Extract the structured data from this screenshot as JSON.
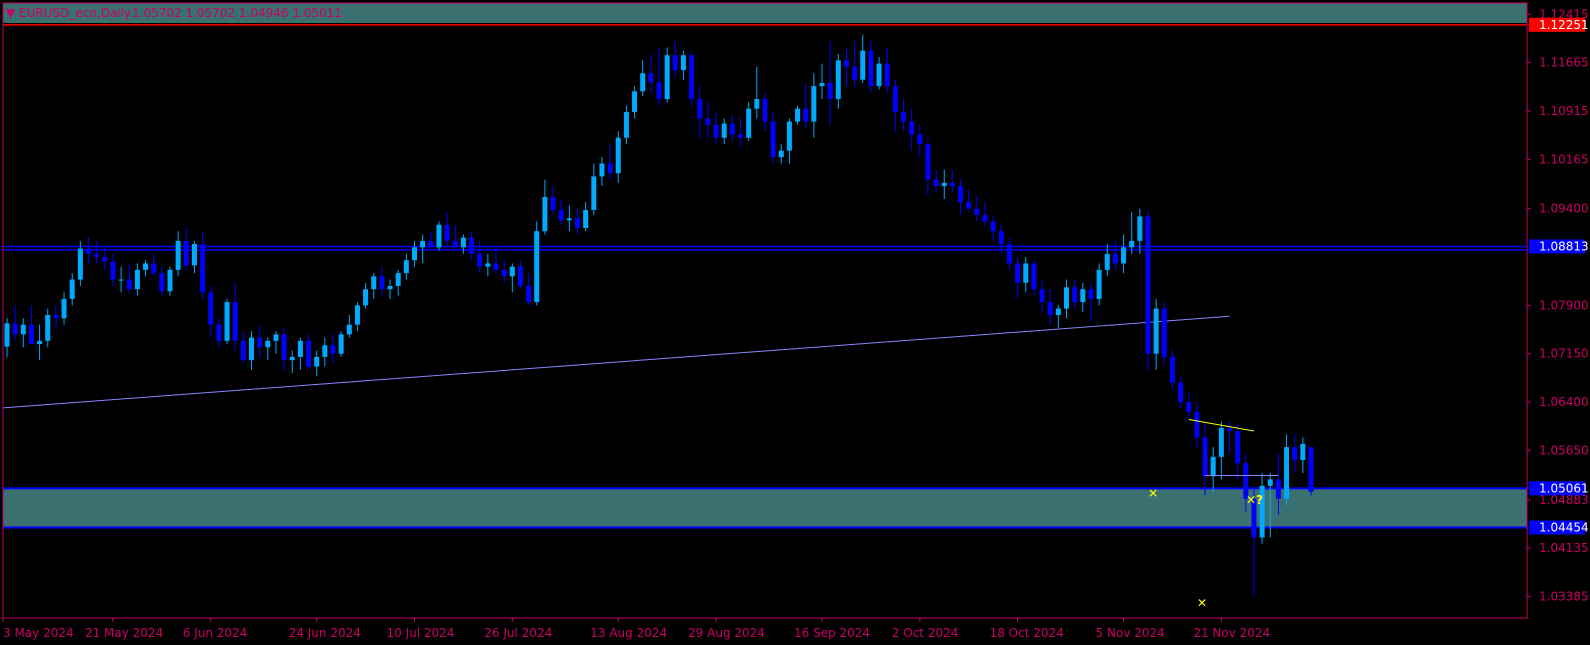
{
  "header": {
    "symbol_label": "EURUSD_ecn,Daily",
    "ohlc": "1.05702 1.05702 1.04946 1.05011",
    "arrow_glyph": "▼"
  },
  "colors": {
    "background": "#000000",
    "frame": "#cc0066",
    "axis_text": "#cc0066",
    "bull_candle": "#00aaff",
    "bear_candle": "#0000ff",
    "zone_fill": "#3a7070",
    "zone_border": "#0000ff",
    "trendline": "#8888ff",
    "level_line": "#0000ff",
    "price_tag_red": "#ff0000",
    "price_tag_blue": "#0000ff",
    "marker": "#ffff00"
  },
  "chart_data": {
    "type": "candlestick",
    "symbol": "EURUSD_ecn",
    "timeframe": "Daily",
    "ylim": [
      1.0305,
      1.1259
    ],
    "yticks": [
      "1.12415",
      "1.11665",
      "1.10915",
      "1.10165",
      "1.09400",
      "1.07900",
      "1.07150",
      "1.06400",
      "1.05650",
      "1.04883",
      "1.04135",
      "1.03385"
    ],
    "xticks": [
      "3 May 2024",
      "21 May 2024",
      "6 Jun 2024",
      "24 Jun 2024",
      "10 Jul 2024",
      "26 Jul 2024",
      "13 Aug 2024",
      "29 Aug 2024",
      "16 Sep 2024",
      "2 Oct 2024",
      "18 Oct 2024",
      "5 Nov 2024",
      "21 Nov 2024"
    ],
    "xtick_index": [
      0,
      13,
      25,
      38,
      50,
      62,
      75,
      87,
      100,
      112,
      124,
      137,
      149
    ],
    "price_tags": [
      {
        "label": "1.12251",
        "value": 1.12251,
        "kind": "red"
      },
      {
        "label": "1.08813",
        "value": 1.08813,
        "kind": "blue"
      },
      {
        "label": "1.05061",
        "value": 1.05061,
        "kind": "blue"
      },
      {
        "label": "1.04454",
        "value": 1.04454,
        "kind": "blue"
      }
    ],
    "horizontal_levels": [
      1.12251,
      1.08813,
      1.0876
    ],
    "zone": {
      "top": 1.05061,
      "bottom": 1.04454
    },
    "trendline": {
      "from": {
        "index": 0,
        "value": 1.0631
      },
      "to": {
        "index": 150,
        "value": 1.0773
      }
    },
    "yellow_lines": [
      {
        "from": {
          "index": 145,
          "value": 1.0613
        },
        "to": {
          "index": 153,
          "value": 1.0595
        }
      },
      {
        "from": {
          "index": 147,
          "value": 1.0526
        },
        "to": {
          "index": 156,
          "value": 1.0526
        }
      }
    ],
    "markers": [
      {
        "index": 141,
        "value": 1.0492,
        "text": "✕"
      },
      {
        "index": 147,
        "value": 1.0322,
        "text": "✕"
      },
      {
        "index": 153,
        "value": 1.0482,
        "text": "✕?"
      }
    ],
    "candles": [
      [
        1.0726,
        1.077,
        1.0709,
        1.0762
      ],
      [
        1.0762,
        1.079,
        1.0735,
        1.0745
      ],
      [
        1.0745,
        1.077,
        1.0725,
        1.076
      ],
      [
        1.076,
        1.079,
        1.0745,
        1.073
      ],
      [
        1.073,
        1.076,
        1.0705,
        1.0735
      ],
      [
        1.0735,
        1.0785,
        1.0725,
        1.0775
      ],
      [
        1.0775,
        1.079,
        1.0755,
        1.077
      ],
      [
        1.077,
        1.081,
        1.076,
        1.08
      ],
      [
        1.08,
        1.084,
        1.079,
        1.083
      ],
      [
        1.083,
        1.089,
        1.082,
        1.0878
      ],
      [
        1.0878,
        1.0895,
        1.0855,
        1.087
      ],
      [
        1.087,
        1.089,
        1.0855,
        1.0865
      ],
      [
        1.0865,
        1.088,
        1.0845,
        1.0858
      ],
      [
        1.0858,
        1.087,
        1.082,
        1.083
      ],
      [
        1.083,
        1.085,
        1.081,
        1.083
      ],
      [
        1.083,
        1.0855,
        1.081,
        1.0815
      ],
      [
        1.0815,
        1.0855,
        1.0805,
        1.0845
      ],
      [
        1.0845,
        1.086,
        1.0835,
        1.0855
      ],
      [
        1.0855,
        1.087,
        1.0835,
        1.084
      ],
      [
        1.084,
        1.085,
        1.0805,
        1.0812
      ],
      [
        1.0812,
        1.085,
        1.0805,
        1.0845
      ],
      [
        1.0845,
        1.0905,
        1.0835,
        1.089
      ],
      [
        1.089,
        1.091,
        1.0845,
        1.0852
      ],
      [
        1.0852,
        1.089,
        1.084,
        1.0885
      ],
      [
        1.0885,
        1.0905,
        1.08,
        1.081
      ],
      [
        1.081,
        1.082,
        1.074,
        1.076
      ],
      [
        1.076,
        1.077,
        1.0725,
        1.0735
      ],
      [
        1.0735,
        1.08,
        1.073,
        1.0795
      ],
      [
        1.0795,
        1.0825,
        1.072,
        1.0735
      ],
      [
        1.0735,
        1.075,
        1.07,
        1.0705
      ],
      [
        1.0705,
        1.075,
        1.069,
        1.074
      ],
      [
        1.074,
        1.076,
        1.071,
        1.0725
      ],
      [
        1.0725,
        1.074,
        1.0705,
        1.0735
      ],
      [
        1.0735,
        1.075,
        1.0715,
        1.0745
      ],
      [
        1.0745,
        1.0755,
        1.069,
        1.0705
      ],
      [
        1.0705,
        1.072,
        1.0685,
        1.071
      ],
      [
        1.071,
        1.074,
        1.069,
        1.0735
      ],
      [
        1.0735,
        1.0745,
        1.069,
        1.0695
      ],
      [
        1.0695,
        1.072,
        1.068,
        1.071
      ],
      [
        1.071,
        1.074,
        1.0695,
        1.0728
      ],
      [
        1.0728,
        1.0745,
        1.07,
        1.0715
      ],
      [
        1.0715,
        1.075,
        1.071,
        1.0745
      ],
      [
        1.0745,
        1.0775,
        1.074,
        1.076
      ],
      [
        1.076,
        1.0795,
        1.075,
        1.079
      ],
      [
        1.079,
        1.0825,
        1.0785,
        1.0815
      ],
      [
        1.0815,
        1.084,
        1.08,
        1.0835
      ],
      [
        1.0835,
        1.085,
        1.0805,
        1.0815
      ],
      [
        1.0815,
        1.083,
        1.08,
        1.082
      ],
      [
        1.082,
        1.0845,
        1.0805,
        1.084
      ],
      [
        1.084,
        1.087,
        1.083,
        1.086
      ],
      [
        1.086,
        1.089,
        1.085,
        1.088
      ],
      [
        1.088,
        1.09,
        1.0855,
        1.089
      ],
      [
        1.089,
        1.0905,
        1.0875,
        1.088
      ],
      [
        1.088,
        1.092,
        1.0875,
        1.0915
      ],
      [
        1.0915,
        1.0935,
        1.088,
        1.089
      ],
      [
        1.089,
        1.0915,
        1.0875,
        1.088
      ],
      [
        1.088,
        1.09,
        1.087,
        1.0895
      ],
      [
        1.0895,
        1.0905,
        1.086,
        1.087
      ],
      [
        1.087,
        1.089,
        1.084,
        1.085
      ],
      [
        1.085,
        1.087,
        1.0835,
        1.0855
      ],
      [
        1.0855,
        1.088,
        1.084,
        1.0845
      ],
      [
        1.0845,
        1.086,
        1.0825,
        1.0835
      ],
      [
        1.0835,
        1.0855,
        1.081,
        1.085
      ],
      [
        1.085,
        1.086,
        1.0815,
        1.082
      ],
      [
        1.082,
        1.084,
        1.079,
        1.0795
      ],
      [
        1.0795,
        1.092,
        1.079,
        1.0905
      ],
      [
        1.0905,
        1.0985,
        1.09,
        1.0958
      ],
      [
        1.0958,
        1.0975,
        1.093,
        1.0938
      ],
      [
        1.0938,
        1.0955,
        1.0915,
        1.0922
      ],
      [
        1.0922,
        1.0945,
        1.0905,
        1.0925
      ],
      [
        1.0925,
        1.094,
        1.09,
        1.091
      ],
      [
        1.091,
        1.095,
        1.0905,
        1.0938
      ],
      [
        1.0938,
        1.101,
        1.093,
        1.099
      ],
      [
        1.099,
        1.102,
        1.0975,
        1.101
      ],
      [
        1.101,
        1.104,
        1.0985,
        1.0995
      ],
      [
        1.0995,
        1.106,
        1.098,
        1.105
      ],
      [
        1.105,
        1.11,
        1.104,
        1.109
      ],
      [
        1.109,
        1.113,
        1.108,
        1.1122
      ],
      [
        1.1122,
        1.117,
        1.1115,
        1.115
      ],
      [
        1.115,
        1.118,
        1.112,
        1.1136
      ],
      [
        1.1136,
        1.119,
        1.11,
        1.111
      ],
      [
        1.111,
        1.119,
        1.1105,
        1.1178
      ],
      [
        1.1178,
        1.12,
        1.1145,
        1.1155
      ],
      [
        1.1155,
        1.1185,
        1.114,
        1.1178
      ],
      [
        1.1178,
        1.1185,
        1.11,
        1.111
      ],
      [
        1.111,
        1.113,
        1.105,
        1.108
      ],
      [
        1.108,
        1.1105,
        1.105,
        1.107
      ],
      [
        1.107,
        1.109,
        1.104,
        1.105
      ],
      [
        1.105,
        1.108,
        1.104,
        1.1072
      ],
      [
        1.1072,
        1.1085,
        1.1045,
        1.1055
      ],
      [
        1.1055,
        1.108,
        1.1035,
        1.105
      ],
      [
        1.105,
        1.1105,
        1.1045,
        1.1095
      ],
      [
        1.1095,
        1.116,
        1.108,
        1.111
      ],
      [
        1.111,
        1.112,
        1.106,
        1.1075
      ],
      [
        1.1075,
        1.109,
        1.101,
        1.102
      ],
      [
        1.102,
        1.104,
        1.101,
        1.103
      ],
      [
        1.103,
        1.108,
        1.101,
        1.1075
      ],
      [
        1.1075,
        1.11,
        1.107,
        1.1095
      ],
      [
        1.1095,
        1.1135,
        1.1065,
        1.1075
      ],
      [
        1.1075,
        1.115,
        1.105,
        1.113
      ],
      [
        1.113,
        1.1165,
        1.111,
        1.1135
      ],
      [
        1.1135,
        1.12,
        1.107,
        1.111
      ],
      [
        1.111,
        1.118,
        1.1095,
        1.117
      ],
      [
        1.117,
        1.119,
        1.113,
        1.116
      ],
      [
        1.116,
        1.12,
        1.113,
        1.114
      ],
      [
        1.114,
        1.121,
        1.1135,
        1.1185
      ],
      [
        1.1185,
        1.12,
        1.112,
        1.113
      ],
      [
        1.113,
        1.1175,
        1.1125,
        1.1165
      ],
      [
        1.1165,
        1.119,
        1.112,
        1.113
      ],
      [
        1.113,
        1.114,
        1.106,
        1.109
      ],
      [
        1.109,
        1.111,
        1.106,
        1.1075
      ],
      [
        1.1075,
        1.1095,
        1.103,
        1.1055
      ],
      [
        1.1055,
        1.107,
        1.102,
        1.104
      ],
      [
        1.104,
        1.105,
        1.096,
        1.0985
      ],
      [
        1.0985,
        1.1,
        1.0965,
        1.0975
      ],
      [
        1.0975,
        1.1,
        1.0955,
        1.098
      ],
      [
        1.098,
        1.1,
        1.0965,
        1.0975
      ],
      [
        1.0975,
        1.0985,
        1.093,
        1.095
      ],
      [
        1.095,
        1.097,
        1.0935,
        1.094
      ],
      [
        1.094,
        1.096,
        1.092,
        1.093
      ],
      [
        1.093,
        1.095,
        1.0915,
        1.092
      ],
      [
        1.092,
        1.093,
        1.089,
        1.0905
      ],
      [
        1.0905,
        1.0915,
        1.087,
        1.0885
      ],
      [
        1.0885,
        1.0895,
        1.0845,
        1.0855
      ],
      [
        1.0855,
        1.0865,
        1.08,
        1.0825
      ],
      [
        1.0825,
        1.0865,
        1.081,
        1.0855
      ],
      [
        1.0855,
        1.086,
        1.0805,
        1.0815
      ],
      [
        1.0815,
        1.083,
        1.078,
        1.0795
      ],
      [
        1.0795,
        1.0815,
        1.076,
        1.0775
      ],
      [
        1.0775,
        1.079,
        1.0755,
        1.0785
      ],
      [
        1.0785,
        1.083,
        1.077,
        1.0818
      ],
      [
        1.0818,
        1.083,
        1.0785,
        1.0795
      ],
      [
        1.0795,
        1.0825,
        1.078,
        1.0815
      ],
      [
        1.0815,
        1.0825,
        1.0765,
        1.08
      ],
      [
        1.08,
        1.0855,
        1.079,
        1.0845
      ],
      [
        1.0845,
        1.0885,
        1.0835,
        1.087
      ],
      [
        1.087,
        1.089,
        1.0845,
        1.0855
      ],
      [
        1.0855,
        1.09,
        1.084,
        1.088
      ],
      [
        1.088,
        1.0935,
        1.087,
        1.089
      ],
      [
        1.089,
        1.094,
        1.087,
        1.0928
      ],
      [
        1.0928,
        1.0935,
        1.069,
        1.0715
      ],
      [
        1.0715,
        1.08,
        1.069,
        1.0785
      ],
      [
        1.0785,
        1.0795,
        1.07,
        1.071
      ],
      [
        1.071,
        1.072,
        1.066,
        1.067
      ],
      [
        1.067,
        1.068,
        1.063,
        1.064
      ],
      [
        1.064,
        1.0655,
        1.0615,
        1.0625
      ],
      [
        1.0625,
        1.064,
        1.057,
        1.0585
      ],
      [
        1.0585,
        1.0605,
        1.0495,
        1.0525
      ],
      [
        1.0525,
        1.057,
        1.05,
        1.0555
      ],
      [
        1.0555,
        1.061,
        1.052,
        1.06
      ],
      [
        1.06,
        1.061,
        1.056,
        1.0595
      ],
      [
        1.0595,
        1.0605,
        1.052,
        1.0545
      ],
      [
        1.0545,
        1.056,
        1.047,
        1.049
      ],
      [
        1.049,
        1.051,
        1.034,
        1.043
      ],
      [
        1.043,
        1.053,
        1.042,
        1.051
      ],
      [
        1.051,
        1.053,
        1.043,
        1.052
      ],
      [
        1.052,
        1.056,
        1.0465,
        1.049
      ],
      [
        1.049,
        1.059,
        1.048,
        1.057
      ],
      [
        1.057,
        1.059,
        1.053,
        1.055
      ],
      [
        1.055,
        1.0585,
        1.053,
        1.0575
      ],
      [
        1.057,
        1.057,
        1.0495,
        1.0501
      ]
    ]
  }
}
